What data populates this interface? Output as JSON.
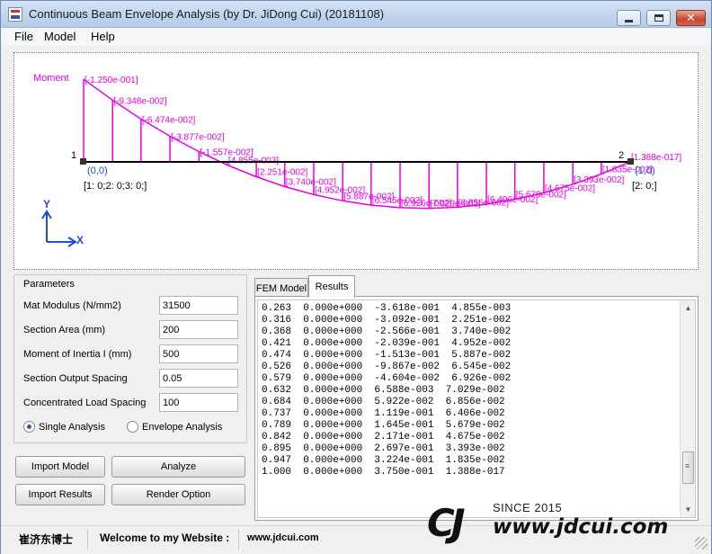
{
  "window": {
    "title": "Continuous Beam Envelope Analysis (by Dr. JiDong Cui) (20181108)",
    "close_glyph": "✕"
  },
  "menu": {
    "file": "File",
    "model": "Model",
    "help": "Help"
  },
  "diagram": {
    "moment_label": "Moment",
    "node1_num": "1",
    "node2_num": "2",
    "node1_coord": "(0,0)",
    "node2_coord": "(1,0)",
    "node1_dof": "[1: 0;2: 0;3: 0;]",
    "node2_dof": "[2: 0;]",
    "axis_y": "Y",
    "axis_x": "X",
    "moment_color": "#e600e6",
    "moment_stations": [
      0.0,
      0.053,
      0.105,
      0.158,
      0.211,
      0.263,
      0.316,
      0.368,
      0.421,
      0.474,
      0.526,
      0.579,
      0.632,
      0.684,
      0.737,
      0.789,
      0.842,
      0.895,
      0.947,
      1.0
    ],
    "moment_values": [
      -0.125,
      -0.09348,
      -0.06474,
      -0.03877,
      -0.01557,
      0.004855,
      0.02251,
      0.0374,
      0.04952,
      0.05887,
      0.06545,
      0.06926,
      0.07029,
      0.06856,
      0.06406,
      0.05679,
      0.04675,
      0.03393,
      0.01835,
      1.388e-18
    ],
    "moment_labels": [
      "[-1.250e-001]",
      "[-9.348e-002]",
      "[-6.474e-002]",
      "[-3.877e-002]",
      "[-1.557e-002]",
      "[4.855e-003]",
      "[2.251e-002]",
      "[3.740e-002]",
      "[4.952e-002]",
      "[5.887e-002]",
      "[6.545e-002]",
      "[6.926e-002]",
      "[7.029e-002]",
      "[6.856e-002]",
      "[6.406e-002]",
      "[5.679e-002]",
      "[4.675e-002]",
      "[3.393e-002]",
      "[1.835e-002]",
      "[1.388e-017]"
    ]
  },
  "params": {
    "title": "Parameters",
    "fields": [
      {
        "label": "Mat Modulus (N/mm2)",
        "value": "31500"
      },
      {
        "label": "Section Area  (mm)",
        "value": "200"
      },
      {
        "label": "Moment of Inertia I (mm)",
        "value": "500"
      },
      {
        "label": "Section Output Spacing",
        "value": "0.05"
      },
      {
        "label": "Concentrated Load Spacing",
        "value": "100"
      }
    ],
    "radio_single": "Single Analysis",
    "radio_envelope": "Envelope Analysis",
    "selected": "single"
  },
  "buttons": {
    "import_model": "Import Model",
    "analyze": "Analyze",
    "import_results": "Import Results",
    "render_option": "Render Option"
  },
  "tabs": {
    "fem_model": "FEM Model",
    "results": "Results",
    "active": "results"
  },
  "results_rows": [
    "0.263  0.000e+000  -3.618e-001  4.855e-003",
    "0.316  0.000e+000  -3.092e-001  2.251e-002",
    "0.368  0.000e+000  -2.566e-001  3.740e-002",
    "0.421  0.000e+000  -2.039e-001  4.952e-002",
    "0.474  0.000e+000  -1.513e-001  5.887e-002",
    "0.526  0.000e+000  -9.867e-002  6.545e-002",
    "0.579  0.000e+000  -4.604e-002  6.926e-002",
    "0.632  0.000e+000  6.588e-003  7.029e-002",
    "0.684  0.000e+000  5.922e-002  6.856e-002",
    "0.737  0.000e+000  1.119e-001  6.406e-002",
    "0.789  0.000e+000  1.645e-001  5.679e-002",
    "0.842  0.000e+000  2.171e-001  4.675e-002",
    "0.895  0.000e+000  2.697e-001  3.393e-002",
    "0.947  0.000e+000  3.224e-001  1.835e-002",
    "1.000  0.000e+000  3.750e-001  1.388e-017"
  ],
  "status": {
    "author": "崔济东博士",
    "welcome": "Welcome to my Website :",
    "website": "www.jdcui.com"
  },
  "logo": {
    "mark": "CJ",
    "since": "SINCE 2015",
    "url": "www.jdcui.com"
  }
}
